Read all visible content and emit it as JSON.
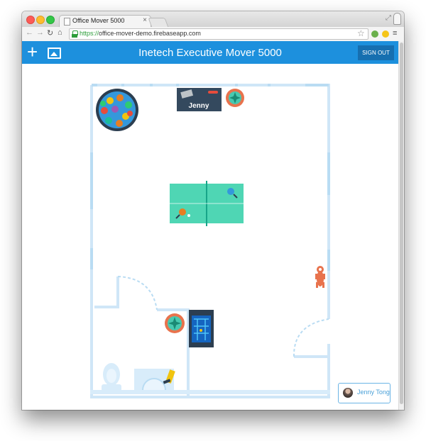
{
  "browser": {
    "tab_title": "Office Mover 5000",
    "tab_close": "×",
    "url_scheme": "https://",
    "url_host": "office-mover-demo.firebaseapp.com"
  },
  "app": {
    "title": "Inetech Executive Mover 5000",
    "add_label": "+",
    "sign_out_label": "SIGN OUT",
    "accent_color": "#1d90dd"
  },
  "furniture": {
    "desk_name": "Jenny"
  },
  "user": {
    "name": "Jenny Tong"
  }
}
